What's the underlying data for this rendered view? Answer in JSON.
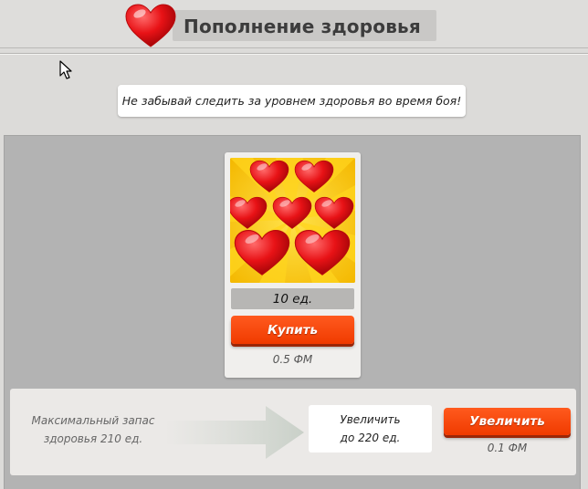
{
  "header": {
    "title": "Пополнение здоровья",
    "icon": "heart-icon"
  },
  "notice": {
    "text": "Не забывай следить за уровнем здоровья во время боя!"
  },
  "product": {
    "image_icon": "hearts-pack-icon",
    "amount": "10 ед.",
    "buy_label": "Купить",
    "price": "0.5 ФМ"
  },
  "upgrade": {
    "current_line1": "Максимальный запас",
    "current_line2": "здоровья 210 ед.",
    "target_line1": "Увеличить",
    "target_line2": "до 220 ед.",
    "button_label": "Увеличить",
    "price": "0.1 ФМ"
  },
  "colors": {
    "accent_button": "#f4440a",
    "heart": "#e81216",
    "card_background": "#f6c400"
  }
}
